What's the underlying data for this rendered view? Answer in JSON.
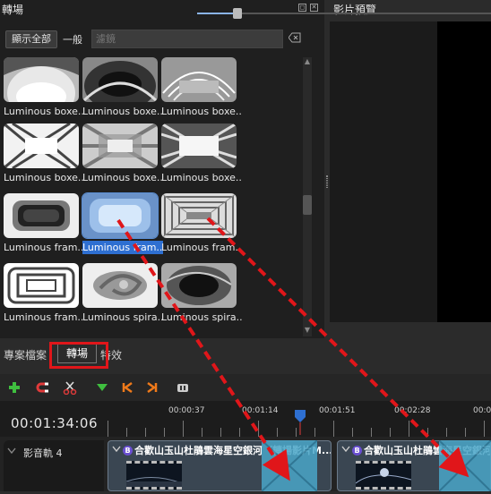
{
  "transitions_panel": {
    "title": "轉場",
    "close_glyph": "✕",
    "float_glyph": "◻",
    "show_all_label": "顯示全部",
    "general_label": "一般",
    "search_placeholder": "濾鏡",
    "items": [
      {
        "label": "Luminous boxe...",
        "style": "arch"
      },
      {
        "label": "Luminous boxe...",
        "style": "arch-dark"
      },
      {
        "label": "Luminous boxe...",
        "style": "arch-lines"
      },
      {
        "label": "Luminous boxe...",
        "style": "burst"
      },
      {
        "label": "Luminous boxe...",
        "style": "burst-soft"
      },
      {
        "label": "Luminous boxe...",
        "style": "burst-bright"
      },
      {
        "label": "Luminous fram...",
        "style": "frame-dark"
      },
      {
        "label": "Luminous fram...",
        "style": "frame-blue",
        "selected": true
      },
      {
        "label": "Luminous fram...",
        "style": "frame-lines"
      },
      {
        "label": "Luminous fram...",
        "style": "frame-rect"
      },
      {
        "label": "Luminous spira...",
        "style": "spiral"
      },
      {
        "label": "Luminous spira...",
        "style": "spiral-dark"
      }
    ]
  },
  "preview_panel": {
    "title": "影片預覽"
  },
  "tabs": {
    "project": "專案檔案",
    "transitions": "轉場",
    "effects": "特效"
  },
  "toolbar": {
    "icons": [
      "add-track-icon",
      "snap-icon",
      "razor-icon",
      "add-marker-icon",
      "previous-marker-icon",
      "next-marker-icon",
      "zoom-icon"
    ]
  },
  "timeline": {
    "current_time": "00:01:34:06",
    "ticks": [
      "00:00:37",
      "00:01:14",
      "00:01:51",
      "00:02:28",
      "00:03"
    ],
    "track_label": "影音軌 4",
    "clips": [
      {
        "badge": "B",
        "title": "合歡山玉山杜鵑雲海星空銀河（轉場影片M..."
      },
      {
        "badge": "B",
        "title": "合歡山玉山杜鵑雲海星空銀河"
      }
    ]
  },
  "colors": {
    "accent": "#2e6fd1",
    "highlight": "#e0161a",
    "arrow": "#e0161a",
    "transition": "#4aa6c8"
  }
}
